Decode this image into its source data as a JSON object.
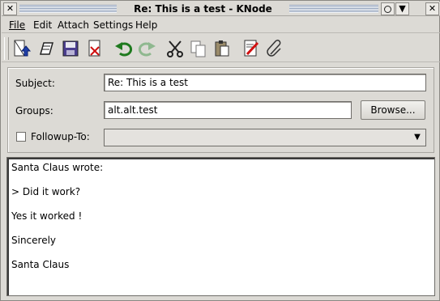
{
  "window": {
    "title": "Re: This is a test - KNode"
  },
  "menubar": {
    "items": [
      "File",
      "Edit",
      "Attach",
      "Settings",
      "Help"
    ]
  },
  "toolbar": {
    "icons": [
      "send-now-icon",
      "send-later-icon",
      "save-icon",
      "delete-icon",
      "undo-icon",
      "redo-icon",
      "cut-icon",
      "copy-icon",
      "paste-icon",
      "spellcheck-icon",
      "attach-icon"
    ]
  },
  "form": {
    "subject_label": "Subject:",
    "subject_value": "Re: This is a test",
    "groups_label": "Groups:",
    "groups_value": "alt.alt.test",
    "browse_label": "Browse...",
    "followup_label": "Followup-To:",
    "followup_checked": false,
    "followup_value": ""
  },
  "body": {
    "lines": [
      "Santa Claus wrote:",
      "> Did it work?",
      "Yes it worked !",
      "Sincerely",
      "Santa Claus"
    ]
  }
}
